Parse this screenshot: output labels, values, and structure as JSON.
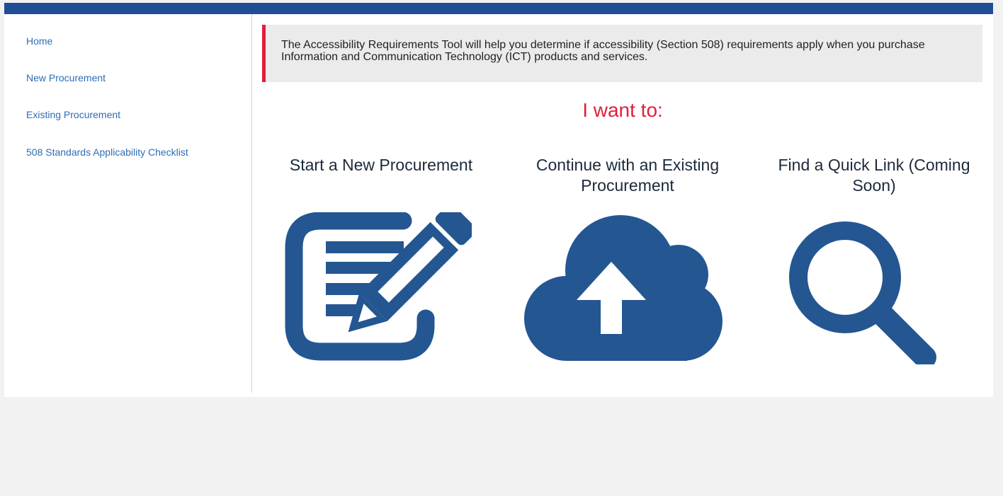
{
  "header": {
    "bar_color": "#1f4e96"
  },
  "sidebar": {
    "items": [
      {
        "label": "Home"
      },
      {
        "label": "New Procurement"
      },
      {
        "label": "Existing Procurement"
      },
      {
        "label": "508 Standards Applicability Checklist"
      }
    ]
  },
  "main": {
    "intro": "The Accessibility Requirements Tool will help you determine if accessibility (Section 508) requirements apply when you purchase Information and Communication Technology (ICT) products and services.",
    "heading": "I want to:",
    "options": [
      {
        "title": "Start a New Procurement",
        "icon": "edit-document-icon"
      },
      {
        "title": "Continue with an Existing Procurement",
        "icon": "cloud-upload-icon"
      },
      {
        "title": "Find a Quick Link (Coming Soon)",
        "icon": "search-icon"
      }
    ]
  },
  "colors": {
    "primary": "#245692",
    "accent": "#e31c3d",
    "link": "#2d6db5"
  }
}
